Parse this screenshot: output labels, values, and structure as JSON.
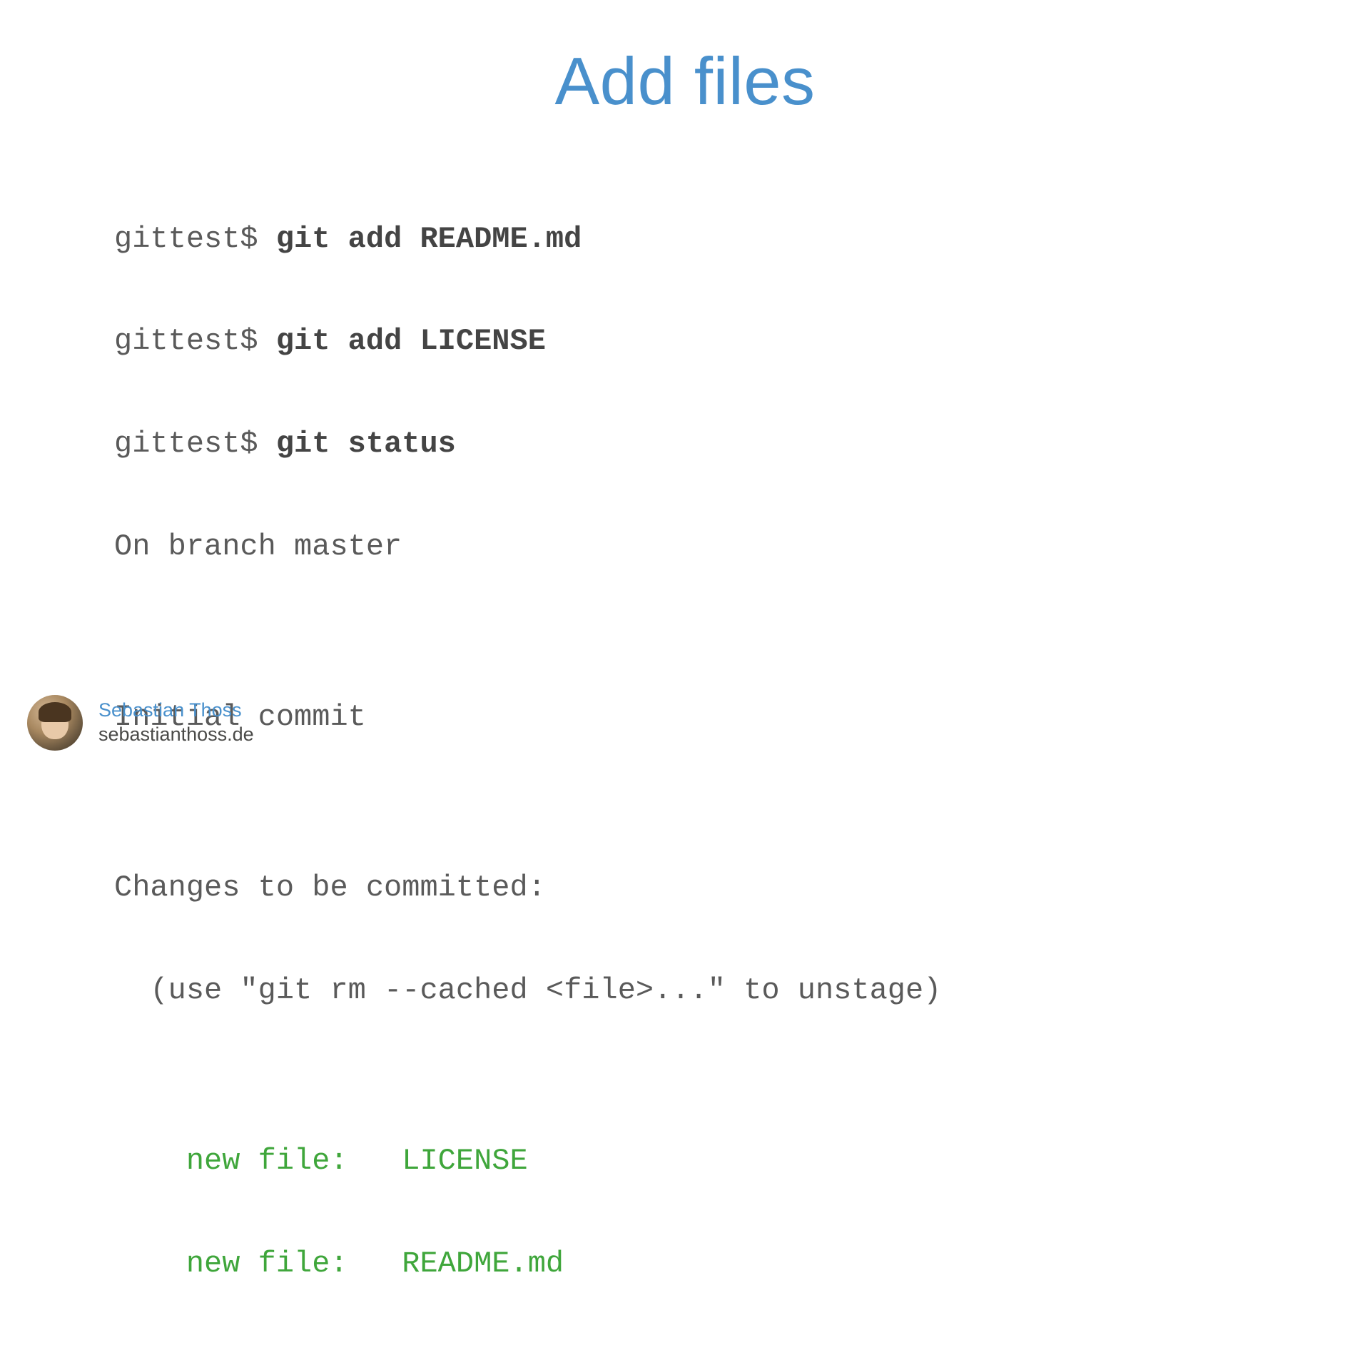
{
  "title": "Add files",
  "code": {
    "line1_prompt": "gittest$ ",
    "line1_cmd": "git add README.md",
    "line2_prompt": "gittest$ ",
    "line2_cmd": "git add LICENSE",
    "line3_prompt": "gittest$ ",
    "line3_cmd": "git status",
    "line4": "On branch master",
    "line5": "",
    "line6": "Initial commit",
    "line7": "",
    "line8": "Changes to be committed:",
    "line9": "  (use \"git rm --cached <file>...\" to unstage)",
    "line10": "",
    "line11": "    new file:   LICENSE",
    "line12": "    new file:   README.md"
  },
  "footer": {
    "author_name": "Sebastian Thoss",
    "author_site": "sebastianthoss.de"
  }
}
